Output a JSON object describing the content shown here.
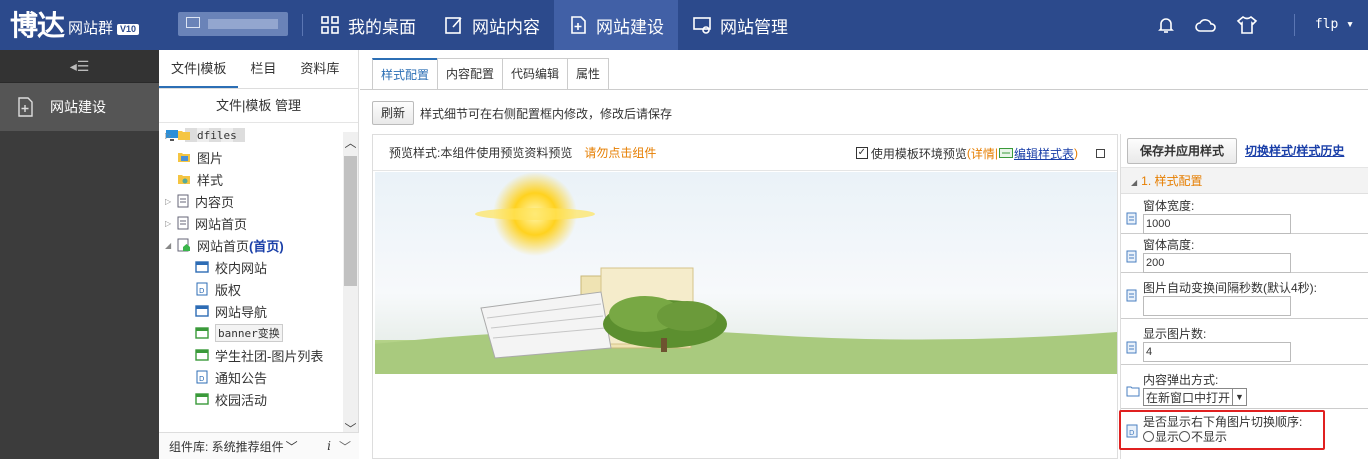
{
  "header": {
    "logo_main": "博达",
    "logo_sub": "网站群",
    "version": "V10",
    "nav": [
      {
        "label": "我的桌面"
      },
      {
        "label": "网站内容"
      },
      {
        "label": "网站建设"
      },
      {
        "label": "网站管理"
      }
    ],
    "user": "flp"
  },
  "sidebar": {
    "toggle_icon": "collapse-menu-icon",
    "items": [
      {
        "label": "网站建设"
      }
    ]
  },
  "tree_panel": {
    "tabs": [
      "文件|模板",
      "栏目",
      "资料库"
    ],
    "title": "文件|模板 管理",
    "nodes": [
      {
        "label": "dfiles",
        "icon": "folder-icon"
      },
      {
        "label": "图片",
        "icon": "image-folder-icon"
      },
      {
        "label": "样式",
        "icon": "style-folder-icon"
      },
      {
        "label": "内容页",
        "icon": "page-icon"
      },
      {
        "label": "网站首页",
        "icon": "page-icon"
      },
      {
        "label": "网站首页",
        "suffix": "(首页)",
        "icon": "home-page-icon"
      },
      {
        "label": "校内网站",
        "icon": "component-icon"
      },
      {
        "label": "版权",
        "icon": "document-icon"
      },
      {
        "label": "网站导航",
        "icon": "component-icon"
      },
      {
        "label": "banner变换",
        "icon": "banner-component-icon"
      },
      {
        "label": "学生社团-图片列表",
        "icon": "banner-component-icon"
      },
      {
        "label": "通知公告",
        "icon": "document-icon"
      },
      {
        "label": "校园活动",
        "icon": "banner-component-icon"
      }
    ],
    "footer": "组件库: 系统推荐组件",
    "footer_i": "i"
  },
  "main": {
    "tabs": [
      "样式配置",
      "内容配置",
      "代码编辑",
      "属性"
    ],
    "refresh": "刷新",
    "hint": "样式细节可在右侧配置框内修改，修改后请保存",
    "preview": {
      "label": "预览样式:本组件使用预览资料预览",
      "warning": "请勿点击组件",
      "use_env": "使用模板环境预览",
      "detail_open": "(",
      "detail": "详情",
      "sep": "|",
      "edit_style": "编辑样式表",
      "detail_close": ")",
      "use_env_checked": true
    }
  },
  "config": {
    "save_button": "保存并应用样式",
    "switch_link": "切换样式/样式历史",
    "section": "1. 样式配置",
    "fields": [
      {
        "label": "窗体宽度:",
        "value": "1000"
      },
      {
        "label": "窗体高度:",
        "value": "200"
      },
      {
        "label": "图片自动变换间隔秒数(默认4秒):",
        "value": ""
      },
      {
        "label": "显示图片数:",
        "value": "4"
      },
      {
        "label": "内容弹出方式:",
        "value": "在新窗口中打开"
      },
      {
        "label": "是否显示右下角图片切换顺序:",
        "options": [
          "显示",
          "不显示"
        ]
      }
    ]
  },
  "colors": {
    "topbar": "#2c4a8c",
    "accent": "#2c6fb5",
    "warning": "#e67e00",
    "highlight": "#e02020"
  }
}
